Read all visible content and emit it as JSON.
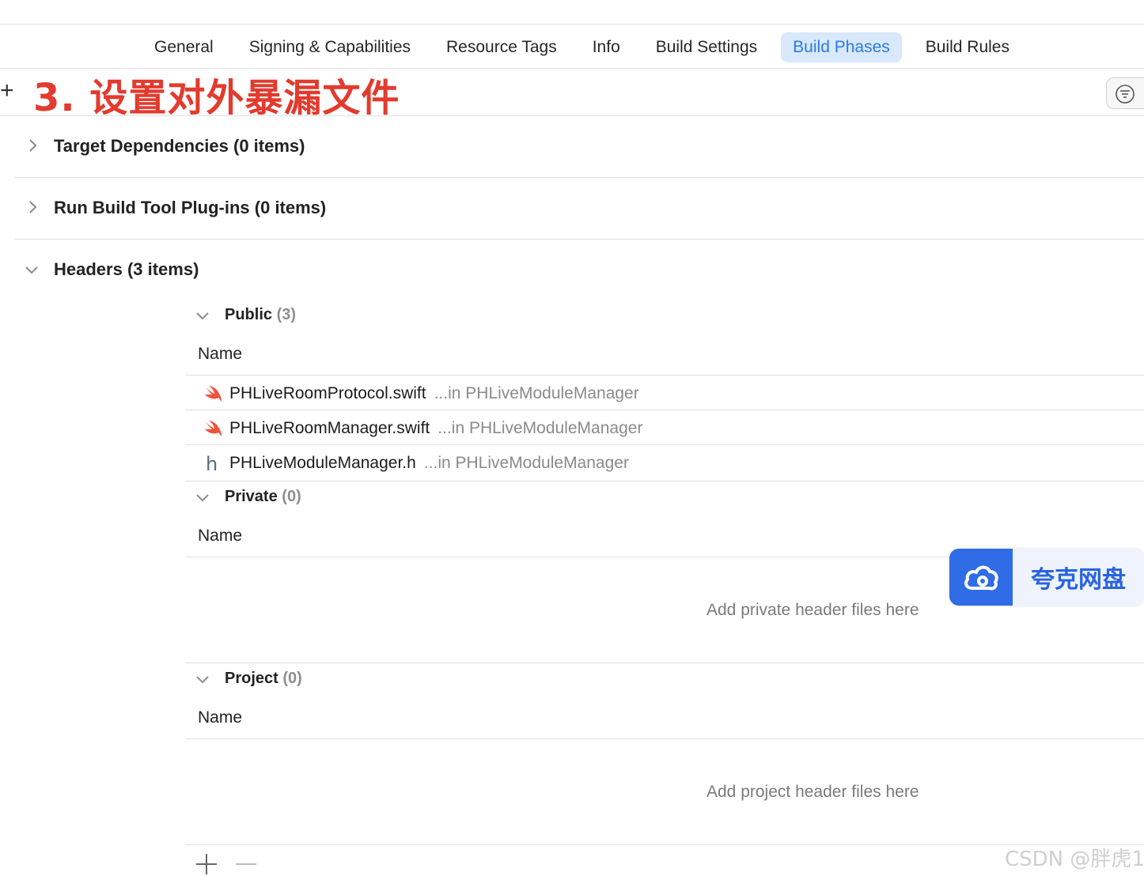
{
  "tabs": [
    {
      "label": "General",
      "active": false
    },
    {
      "label": "Signing & Capabilities",
      "active": false
    },
    {
      "label": "Resource Tags",
      "active": false
    },
    {
      "label": "Info",
      "active": false
    },
    {
      "label": "Build Settings",
      "active": false
    },
    {
      "label": "Build Phases",
      "active": true
    },
    {
      "label": "Build Rules",
      "active": false
    }
  ],
  "toolbar": {
    "add_symbol": "+"
  },
  "annotation": "3. 设置对外暴漏文件",
  "sections": {
    "target_dependencies": "Target Dependencies (0 items)",
    "run_build_tool_plugins": "Run Build Tool Plug-ins (0 items)",
    "headers": "Headers (3 items)"
  },
  "headers": {
    "public": {
      "title": "Public",
      "count": "(3)",
      "column": "Name",
      "files": [
        {
          "icon": "swift-icon",
          "name": "PHLiveRoomProtocol.swift",
          "location": "...in PHLiveModuleManager"
        },
        {
          "icon": "swift-icon",
          "name": "PHLiveRoomManager.swift",
          "location": "...in PHLiveModuleManager"
        },
        {
          "icon": "header-file-icon",
          "name": "PHLiveModuleManager.h",
          "location": "...in PHLiveModuleManager"
        }
      ]
    },
    "private": {
      "title": "Private",
      "count": "(0)",
      "column": "Name",
      "placeholder": "Add private header files here"
    },
    "project": {
      "title": "Project",
      "count": "(0)",
      "column": "Name",
      "placeholder": "Add project header files here"
    }
  },
  "overlay": {
    "label": "夸克网盘",
    "brand_color": "#2f6ce6"
  },
  "watermark": "CSDN @胖虎1",
  "colors": {
    "accent": "#2a7be4",
    "annotation": "#e23b2e",
    "swift": "#f05138"
  }
}
